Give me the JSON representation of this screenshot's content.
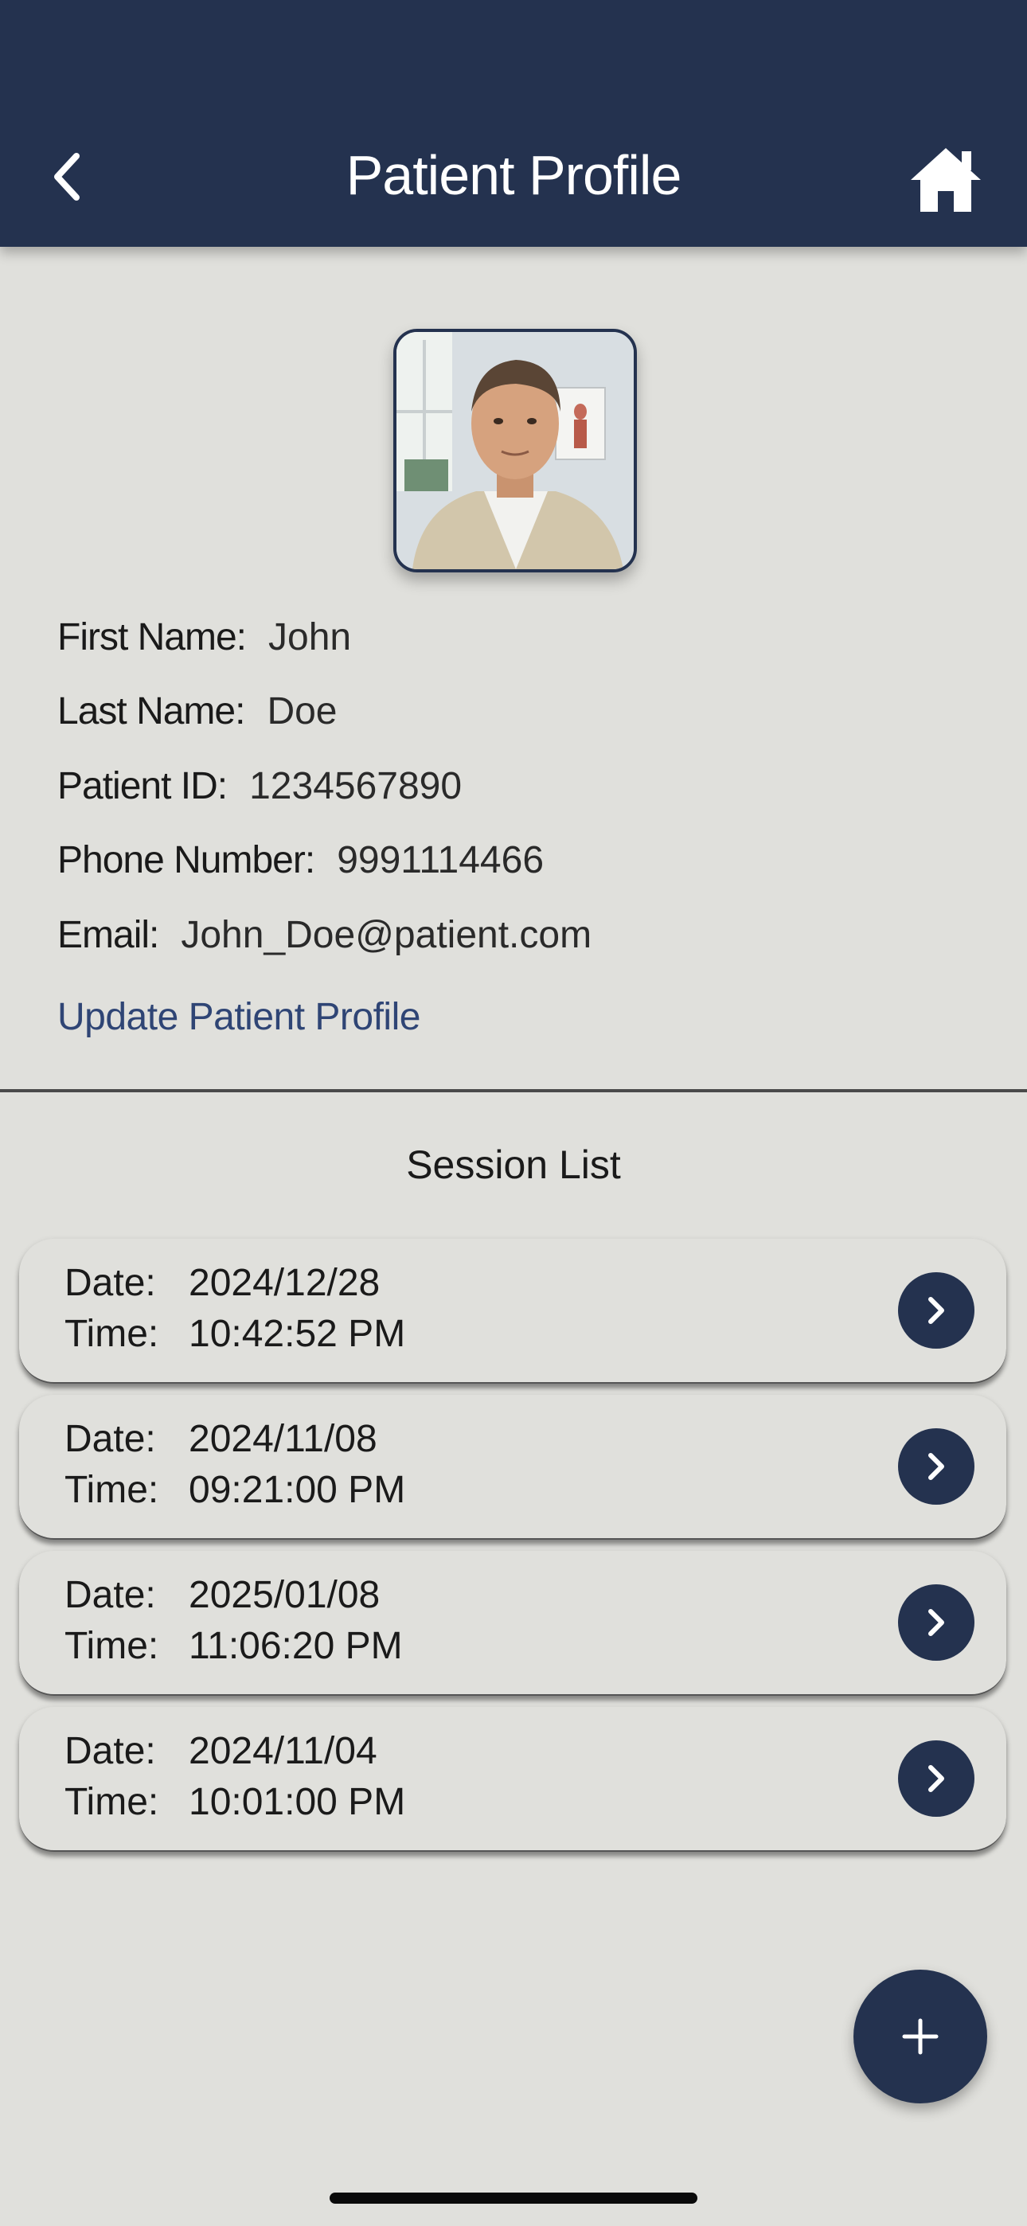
{
  "header": {
    "title": "Patient Profile",
    "back_icon": "chevron-left-icon",
    "home_icon": "home-icon"
  },
  "patient": {
    "first_name_label": "First Name:",
    "first_name": "John",
    "last_name_label": "Last Name:",
    "last_name": "Doe",
    "id_label": "Patient ID:",
    "id": "1234567890",
    "phone_label": "Phone Number:",
    "phone": "9991114466",
    "email_label": "Email:",
    "email": "John_Doe@patient.com",
    "update_link": "Update Patient Profile"
  },
  "sessions": {
    "title": "Session List",
    "date_label": "Date:",
    "time_label": "Time:",
    "items": [
      {
        "date": "2024/12/28",
        "time": "10:42:52 PM"
      },
      {
        "date": "2024/11/08",
        "time": "09:21:00 PM"
      },
      {
        "date": "2025/01/08",
        "time": "11:06:20 PM"
      },
      {
        "date": "2024/11/04",
        "time": "10:01:00 PM"
      }
    ]
  },
  "fab_icon": "plus-icon",
  "colors": {
    "brand": "#24324f",
    "background": "#e0e0dc",
    "link": "#2f4575"
  }
}
